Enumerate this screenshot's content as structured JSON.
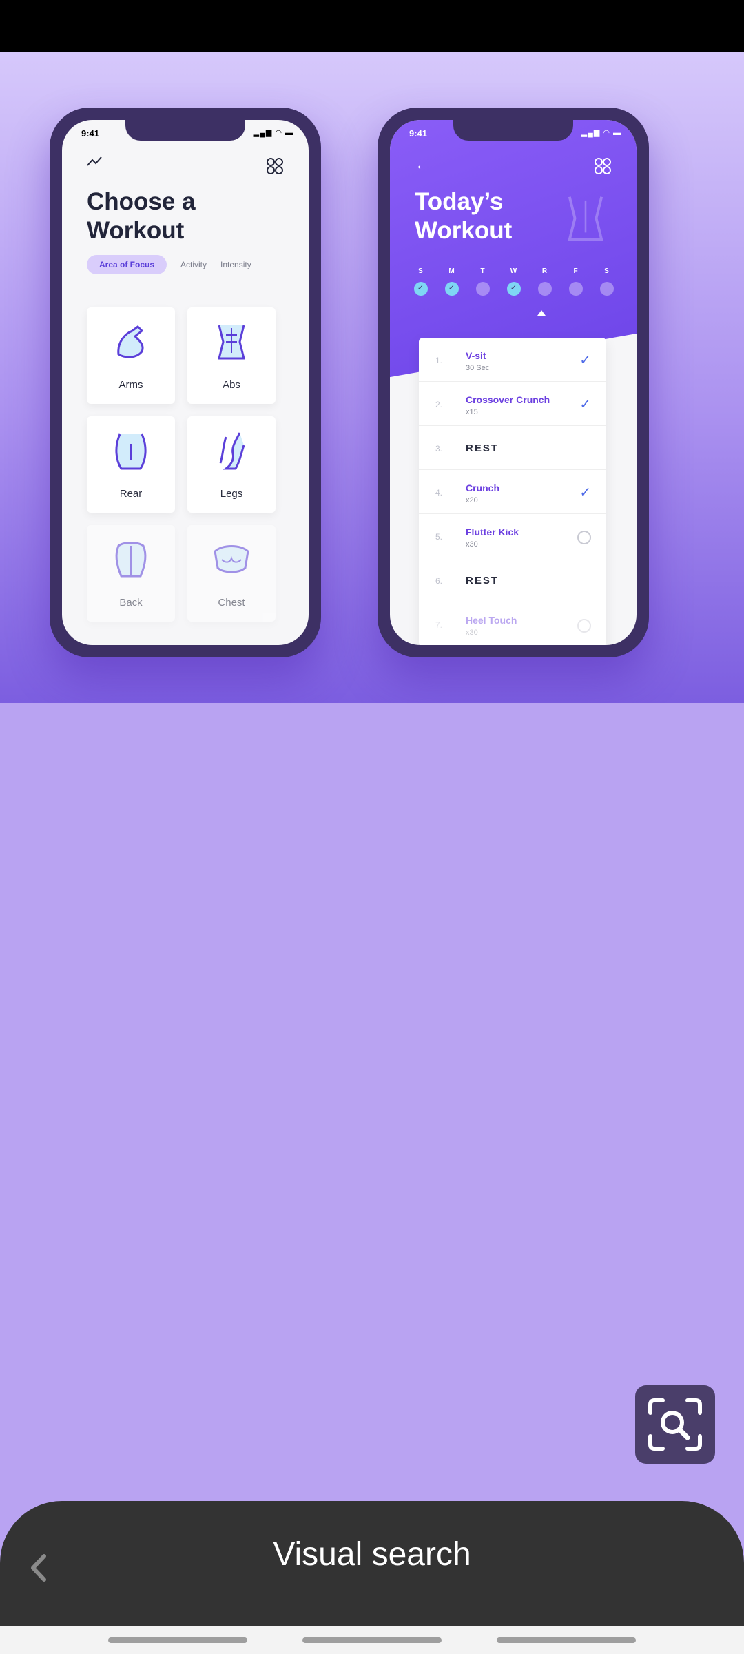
{
  "left_phone": {
    "time": "9:41",
    "title": "Choose a Workout",
    "tabs": [
      {
        "label": "Area of Focus",
        "active": true
      },
      {
        "label": "Activity",
        "active": false
      },
      {
        "label": "Intensity",
        "active": false
      }
    ],
    "tiles": [
      {
        "label": "Arms"
      },
      {
        "label": "Abs"
      },
      {
        "label": "Rear"
      },
      {
        "label": "Legs"
      },
      {
        "label": "Back"
      },
      {
        "label": "Chest"
      }
    ]
  },
  "right_phone": {
    "time": "9:41",
    "title": "Today’s Workout",
    "days": [
      {
        "letter": "S",
        "done": true
      },
      {
        "letter": "M",
        "done": true
      },
      {
        "letter": "T",
        "done": false
      },
      {
        "letter": "W",
        "done": true
      },
      {
        "letter": "R",
        "done": false
      },
      {
        "letter": "F",
        "done": false
      },
      {
        "letter": "S",
        "done": false
      }
    ],
    "exercises": [
      {
        "num": "1.",
        "name": "V-sit",
        "detail": "30 Sec",
        "status": "done"
      },
      {
        "num": "2.",
        "name": "Crossover Crunch",
        "detail": "x15",
        "status": "done"
      },
      {
        "num": "3.",
        "name": "REST",
        "detail": "",
        "status": "rest"
      },
      {
        "num": "4.",
        "name": "Crunch",
        "detail": "x20",
        "status": "done"
      },
      {
        "num": "5.",
        "name": "Flutter Kick",
        "detail": "x30",
        "status": "todo"
      },
      {
        "num": "6.",
        "name": "REST",
        "detail": "",
        "status": "rest"
      },
      {
        "num": "7.",
        "name": "Heel Touch",
        "detail": "x30",
        "status": "todo"
      }
    ]
  },
  "sheet": {
    "title": "Visual search"
  },
  "colors": {
    "background": "#b9a3f2",
    "sheet": "#333333",
    "accent": "#6c44e8",
    "lens_button": "#4a3e6a"
  },
  "icons": {
    "lens": "visual-search-icon",
    "back": "chevron-left-icon"
  }
}
